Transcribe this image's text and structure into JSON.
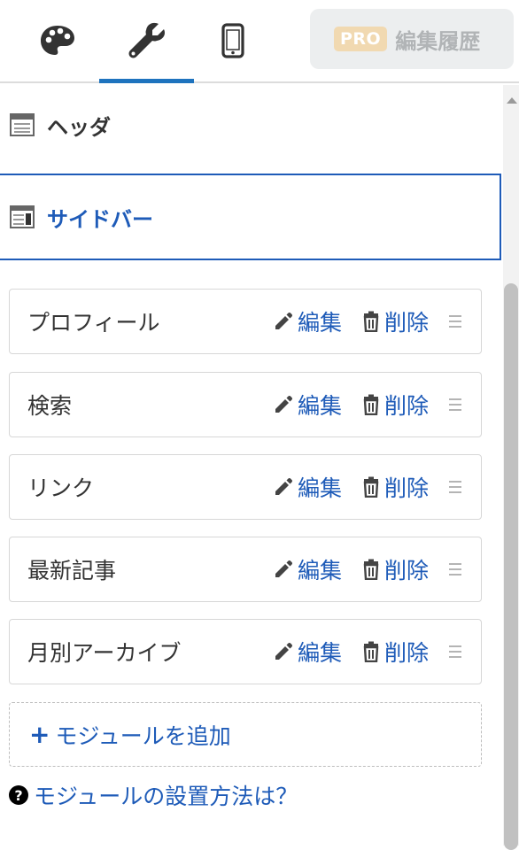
{
  "tabs": [
    {
      "icon": "palette-icon",
      "active": false
    },
    {
      "icon": "wrench-icon",
      "active": true
    },
    {
      "icon": "smartphone-icon",
      "active": false
    }
  ],
  "history": {
    "badge": "PRO",
    "label": "編集履歴"
  },
  "areas": {
    "header": {
      "label": "ヘッダ"
    },
    "sidebar": {
      "label": "サイドバー",
      "selected": true
    }
  },
  "modules": [
    {
      "name": "プロフィール",
      "edit_label": "編集",
      "delete_label": "削除"
    },
    {
      "name": "検索",
      "edit_label": "編集",
      "delete_label": "削除"
    },
    {
      "name": "リンク",
      "edit_label": "編集",
      "delete_label": "削除"
    },
    {
      "name": "最新記事",
      "edit_label": "編集",
      "delete_label": "削除"
    },
    {
      "name": "月別アーカイブ",
      "edit_label": "編集",
      "delete_label": "削除"
    }
  ],
  "add_module": {
    "plus": "+",
    "label": "モジュールを追加"
  },
  "help": {
    "icon_glyph": "?",
    "label": "モジュールの設置方法は？"
  },
  "colors": {
    "accent": "#1e5bb8",
    "tab_indicator": "#1e73be",
    "pro_badge": "#f1d9b1",
    "history_text": "#b1b4b6"
  }
}
